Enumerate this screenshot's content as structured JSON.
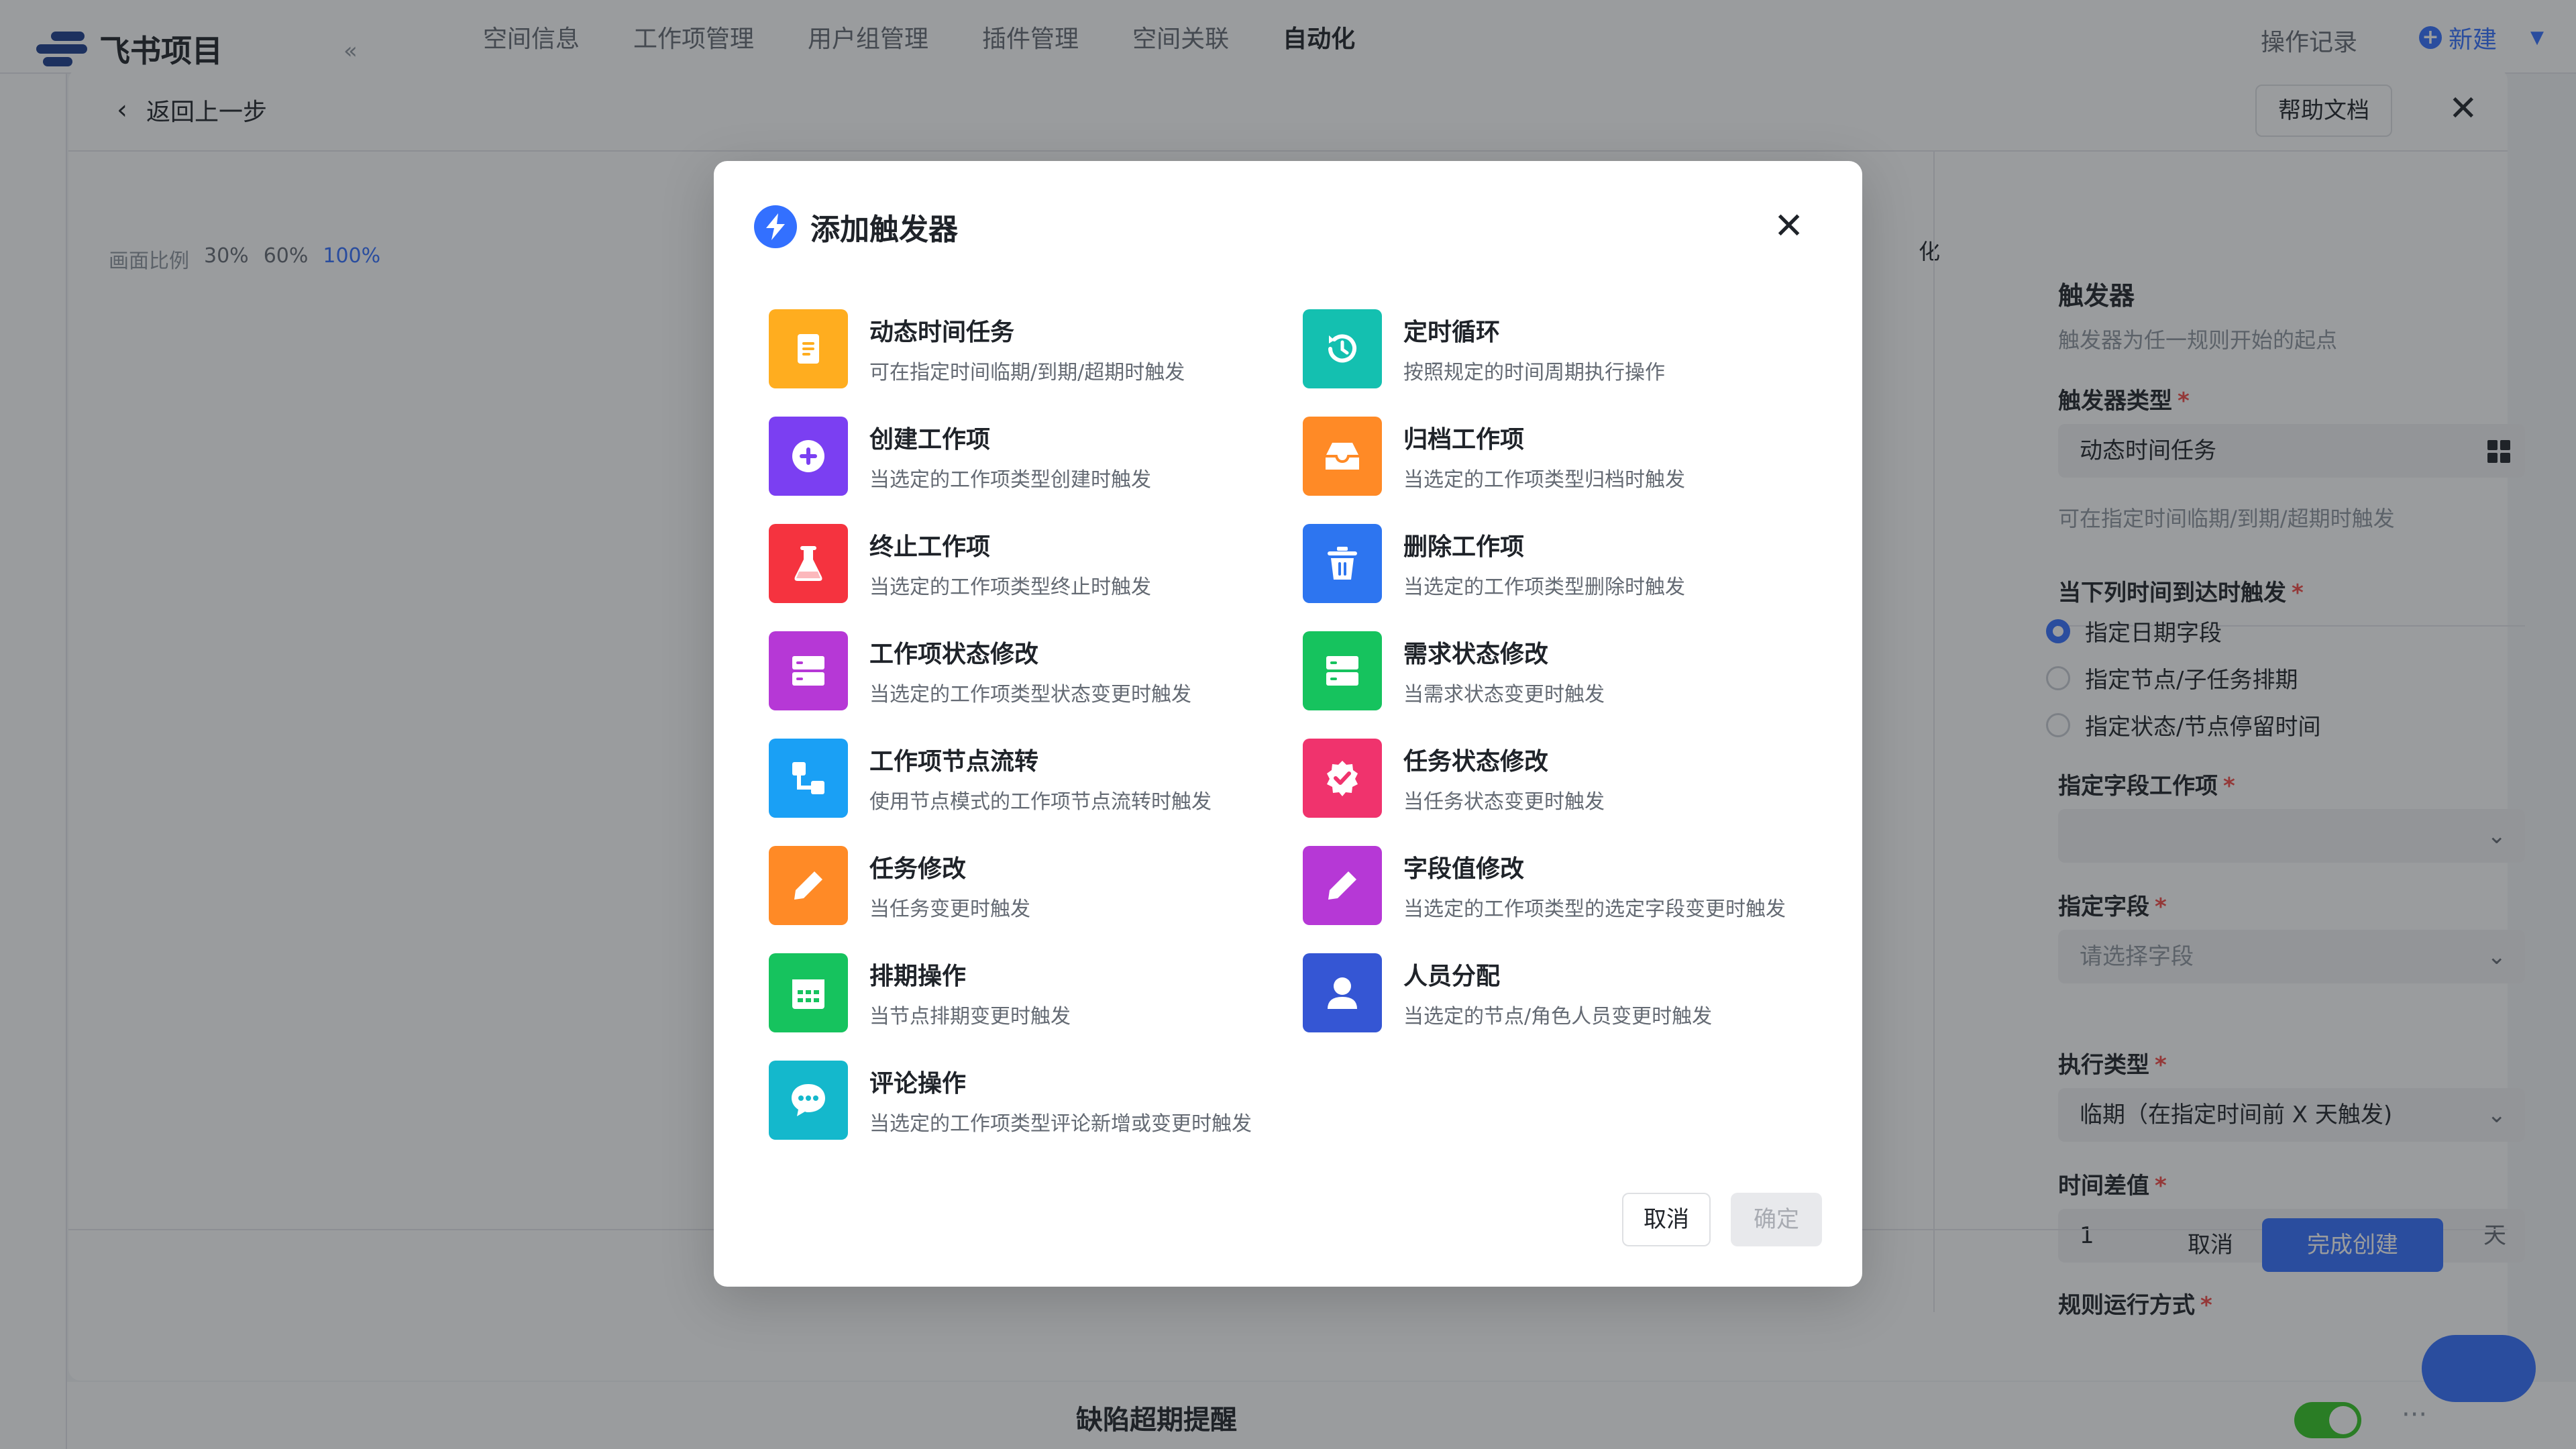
{
  "app": {
    "logo_text": "飞书项目",
    "nav": [
      "空间信息",
      "工作项管理",
      "用户组管理",
      "插件管理",
      "空间关联",
      "自动化"
    ],
    "op_log": "操作记录",
    "new_label": "新建",
    "bottom_rule_title": "缺陷超期提醒"
  },
  "panel": {
    "back_label": "返回上一步",
    "help_label": "帮助文档",
    "zoom": {
      "label": "画面比例",
      "options": [
        "30%",
        "60%",
        "100%"
      ]
    },
    "canvas_hint": "化",
    "trigger_title": "触发器",
    "trigger_desc": "触发器为任一规则开始的起点",
    "type_label": "触发器类型",
    "type_value": "动态时间任务",
    "type_hint": "可在指定时间临期/到期/超期时触发",
    "when_label": "当下列时间到达时触发",
    "radios": [
      "指定日期字段",
      "指定节点/子任务排期",
      "指定状态/节点停留时间"
    ],
    "field_item_label": "指定字段工作项",
    "field_label": "指定字段",
    "field_placeholder": "请选择字段",
    "exec_label": "执行类型",
    "exec_value": "临期（在指定时间前 X 天触发)",
    "diff_label": "时间差值",
    "diff_value": "1",
    "diff_unit": "天",
    "run_label": "规则运行方式",
    "cancel_label": "取消",
    "done_label": "完成创建"
  },
  "modal": {
    "title": "添加触发器",
    "cancel_label": "取消",
    "ok_label": "确定",
    "triggers": [
      {
        "name": "动态时间任务",
        "desc": "可在指定时间临期/到期/超期时触发",
        "color": "#ffad1f",
        "icon": "document-icon"
      },
      {
        "name": "定时循环",
        "desc": "按照规定的时间周期执行操作",
        "color": "#14c0b0",
        "icon": "history-icon"
      },
      {
        "name": "创建工作项",
        "desc": "当选定的工作项类型创建时触发",
        "color": "#7b3ff2",
        "icon": "plus-circle-icon"
      },
      {
        "name": "归档工作项",
        "desc": "当选定的工作项类型归档时触发",
        "color": "#ff8a26",
        "icon": "inbox-icon"
      },
      {
        "name": "终止工作项",
        "desc": "当选定的工作项类型终止时触发",
        "color": "#f5333f",
        "icon": "flask-icon"
      },
      {
        "name": "删除工作项",
        "desc": "当选定的工作项类型删除时触发",
        "color": "#2d75f0",
        "icon": "trash-icon"
      },
      {
        "name": "工作项状态修改",
        "desc": "当选定的工作项类型状态变更时触发",
        "color": "#b638d6",
        "icon": "server-icon"
      },
      {
        "name": "需求状态修改",
        "desc": "当需求状态变更时触发",
        "color": "#16c35e",
        "icon": "server-icon"
      },
      {
        "name": "工作项节点流转",
        "desc": "使用节点模式的工作项节点流转时触发",
        "color": "#1aa0f5",
        "icon": "flow-icon"
      },
      {
        "name": "任务状态修改",
        "desc": "当任务状态变更时触发",
        "color": "#f0336d",
        "icon": "badge-check-icon"
      },
      {
        "name": "任务修改",
        "desc": "当任务变更时触发",
        "color": "#ff8a26",
        "icon": "pencil-icon"
      },
      {
        "name": "字段值修改",
        "desc": "当选定的工作项类型的选定字段变更时触发",
        "color": "#b638d6",
        "icon": "pencil-icon"
      },
      {
        "name": "排期操作",
        "desc": "当节点排期变更时触发",
        "color": "#16c35e",
        "icon": "calendar-icon"
      },
      {
        "name": "人员分配",
        "desc": "当选定的节点/角色人员变更时触发",
        "color": "#3556d4",
        "icon": "person-icon"
      },
      {
        "name": "评论操作",
        "desc": "当选定的工作项类型评论新增或变更时触发",
        "color": "#14b8cc",
        "icon": "chat-icon"
      }
    ]
  }
}
